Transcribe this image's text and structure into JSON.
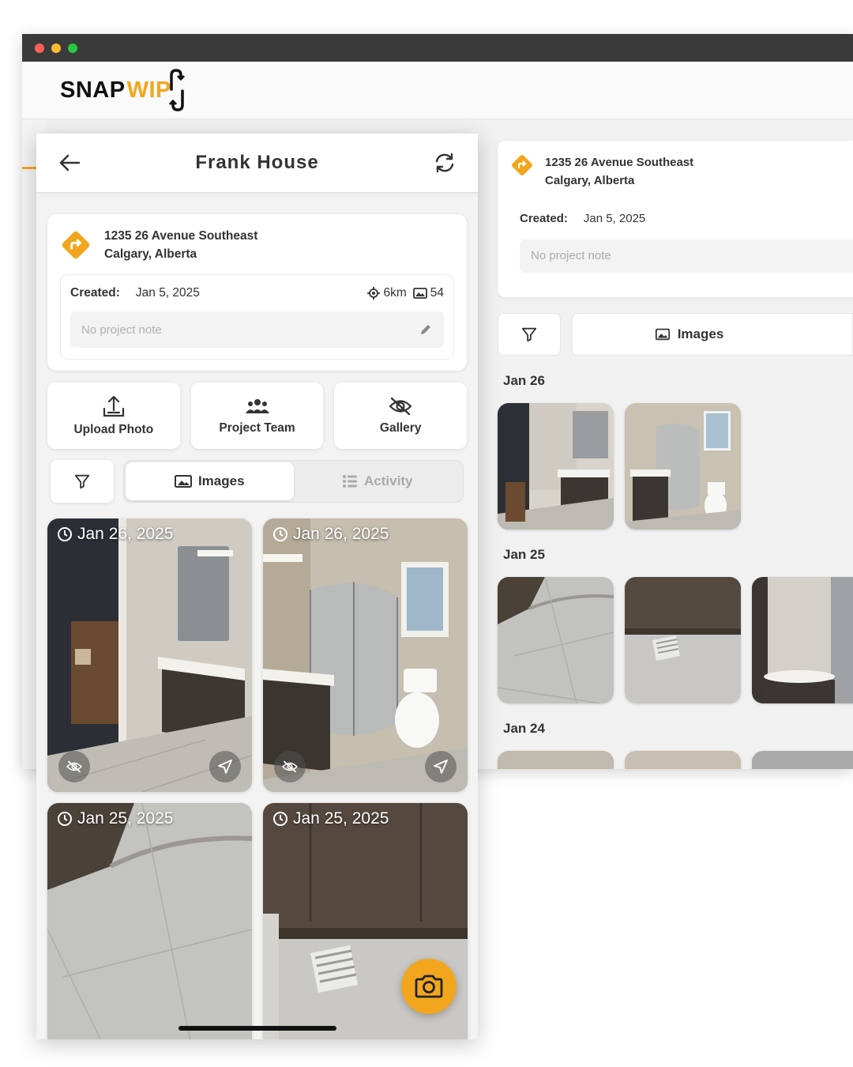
{
  "brand": {
    "logo_left": "SNAP",
    "logo_right": "WIP",
    "accent": "#f2a61d"
  },
  "project": {
    "title": "Frank House",
    "address_line1": "1235 26 Avenue Southeast",
    "address_line2": "Calgary, Alberta",
    "created_label": "Created:",
    "created_date": "Jan 5, 2025",
    "distance": "6km",
    "photo_count": "54",
    "note_placeholder": "No project note"
  },
  "actions": [
    {
      "label": "Upload Photo",
      "icon": "upload-icon"
    },
    {
      "label": "Project Team",
      "icon": "team-icon"
    },
    {
      "label": "Gallery",
      "icon": "eye-off-icon"
    }
  ],
  "tabs": {
    "images": "Images",
    "activity": "Activity"
  },
  "photos": [
    {
      "date": "Jan 26, 2025"
    },
    {
      "date": "Jan 26, 2025"
    },
    {
      "date": "Jan 25, 2025"
    },
    {
      "date": "Jan 25, 2025"
    }
  ],
  "desktop": {
    "groups": [
      {
        "date": "Jan 26"
      },
      {
        "date": "Jan 25"
      },
      {
        "date": "Jan 24"
      }
    ]
  }
}
